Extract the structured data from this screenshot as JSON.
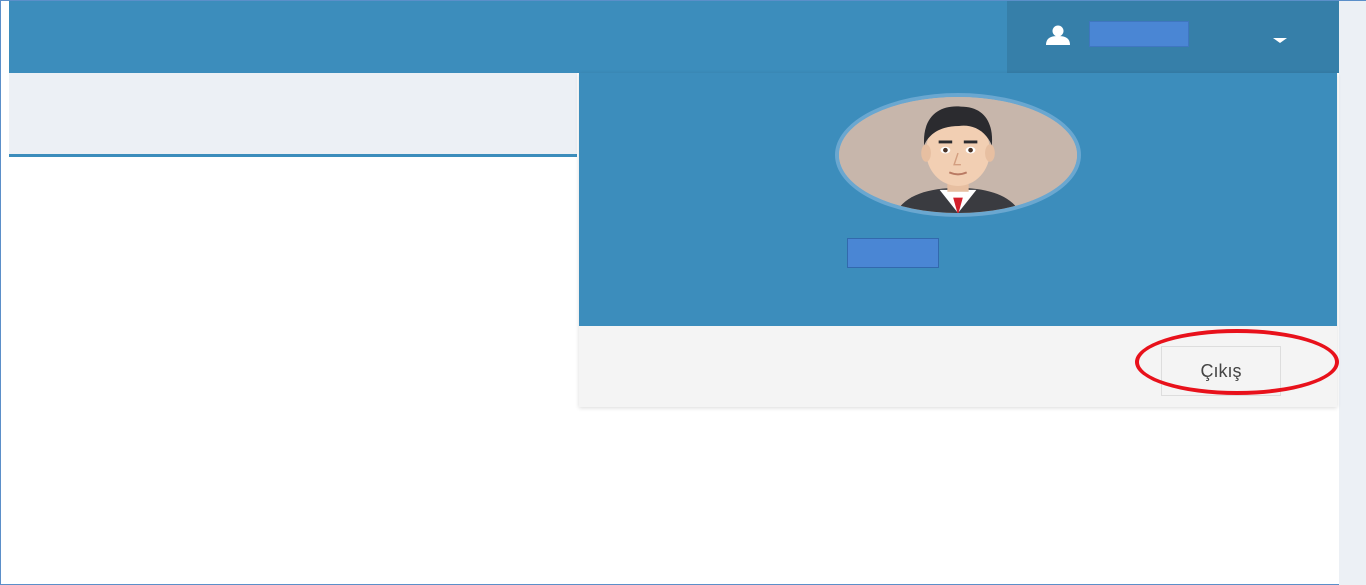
{
  "colors": {
    "navbar": "#3c8dbc",
    "user_menu": "#367fa9",
    "content_bg": "#ecf0f5",
    "redaction": "#4a86d4",
    "highlight": "#e8111b"
  },
  "navbar": {
    "user_icon": "user-icon",
    "caret_icon": "caret-down-icon"
  },
  "dropdown": {
    "avatar_icon": "avatar-image",
    "logout_label": "Çıkış"
  }
}
